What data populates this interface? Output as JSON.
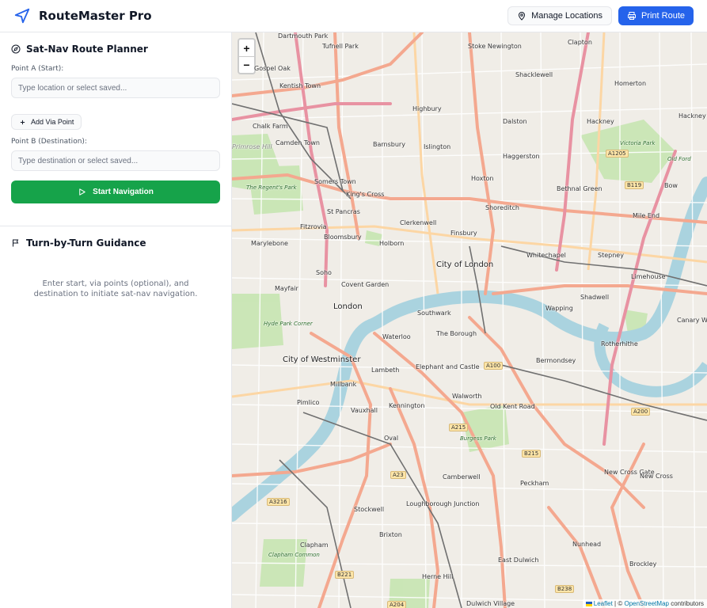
{
  "header": {
    "title": "RouteMaster Pro",
    "manage_label": "Manage Locations",
    "print_label": "Print Route"
  },
  "planner": {
    "title": "Sat-Nav Route Planner",
    "point_a_label": "Point A (Start):",
    "point_a_placeholder": "Type location or select saved...",
    "via_label": "Add Via Point",
    "point_b_label": "Point B (Destination):",
    "point_b_placeholder": "Type destination or select saved...",
    "start_label": "Start Navigation"
  },
  "guidance": {
    "title": "Turn-by-Turn Guidance",
    "empty_text": "Enter start, via points (optional), and destination to initiate sat-nav navigation."
  },
  "map": {
    "zoom_in": "+",
    "zoom_out": "−",
    "attribution_leaflet": "Leaflet",
    "attribution_sep": "| ©",
    "attribution_osm": "OpenStreetMap",
    "attribution_tail": "contributors",
    "labels": [
      "Dartmouth Park",
      "Tufnell Park",
      "Stoke Newington",
      "Clapton",
      "Gospel Oak",
      "Kentish Town",
      "Shacklewell",
      "Homerton",
      "Highbury",
      "Chalk Farm",
      "Dalston",
      "Hackney",
      "Hackney Wick",
      "Camden Town",
      "Barnsbury",
      "Islington",
      "Haggerston",
      "Primrose Hill",
      "Somers Town",
      "King's Cross",
      "Hoxton",
      "Bethnal Green",
      "Bow",
      "St Pancras",
      "Shoreditch",
      "Mile End",
      "Fitzrovia",
      "Bloomsbury",
      "Clerkenwell",
      "Finsbury",
      "Marylebone",
      "Holborn",
      "City of London",
      "Whitechapel",
      "Stepney",
      "Soho",
      "Covent Garden",
      "Limehouse",
      "Mayfair",
      "London",
      "Shadwell",
      "Southwark",
      "Wapping",
      "Canary W",
      "Waterloo",
      "The Borough",
      "Rotherhithe",
      "City of Westminster",
      "Lambeth",
      "Elephant and Castle",
      "Bermondsey",
      "Millbank",
      "Walworth",
      "Pimlico",
      "Vauxhall",
      "Kennington",
      "Old Kent Road",
      "Oval",
      "Camberwell",
      "Peckham",
      "New Cross Gate",
      "New Cross",
      "Stockwell",
      "Loughborough Junction",
      "Brixton",
      "Clapham",
      "Nunhead",
      "East Dulwich",
      "Brockley",
      "Herne Hill",
      "Dulwich Village",
      "The Regent's Park",
      "Hyde Park Corner",
      "Victoria Park",
      "Old Ford",
      "Clapham Common",
      "Burgess Park"
    ],
    "roads": [
      "A1205",
      "B119",
      "A100",
      "A200",
      "A215",
      "B215",
      "A23",
      "A3216",
      "B221",
      "B238",
      "A204"
    ]
  }
}
